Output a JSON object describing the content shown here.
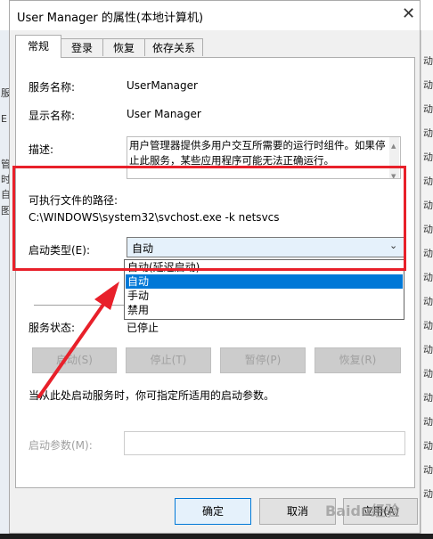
{
  "window": {
    "title": "User Manager 的属性(本地计算机)"
  },
  "tabs": [
    {
      "label": "常规"
    },
    {
      "label": "登录"
    },
    {
      "label": "恢复"
    },
    {
      "label": "依存关系"
    }
  ],
  "general": {
    "service_name_label": "服务名称:",
    "service_name_value": "UserManager",
    "display_name_label": "显示名称:",
    "display_name_value": "User Manager",
    "description_label": "描述:",
    "description_value": "用户管理器提供多用户交互所需要的运行时组件。如果停止此服务，某些应用程序可能无法正确运行。",
    "path_label": "可执行文件的路径:",
    "path_value": "C:\\WINDOWS\\system32\\svchost.exe -k netsvcs",
    "startup_type_label": "启动类型(E):",
    "startup_type_value": "自动",
    "startup_type_options": [
      "自动(延迟启动)",
      "自动",
      "手动",
      "禁用"
    ],
    "startup_type_selected_index": 1,
    "service_status_label": "服务状态:",
    "service_status_value": "已停止",
    "start_button": "启动(S)",
    "stop_button": "停止(T)",
    "pause_button": "暂停(P)",
    "resume_button": "恢复(R)",
    "hint_text": "当从此处启动服务时，你可指定所适用的启动参数。",
    "start_params_label": "启动参数(M):",
    "start_params_value": ""
  },
  "footer": {
    "ok": "确定",
    "cancel": "取消",
    "apply": "应用(A)"
  },
  "background": {
    "left_chars": [
      "服",
      "E",
      "管",
      "时",
      "自",
      "图"
    ],
    "right_chars": [
      "动",
      "动",
      "动",
      "动",
      "动",
      "动",
      "动",
      "动",
      "动",
      "动",
      "动",
      "动",
      "动",
      "动",
      "动",
      "动",
      "动",
      "动",
      "动"
    ]
  },
  "watermark": "Baidu经验",
  "colors": {
    "highlight": "#0078d7",
    "annotation": "#e8202a"
  }
}
